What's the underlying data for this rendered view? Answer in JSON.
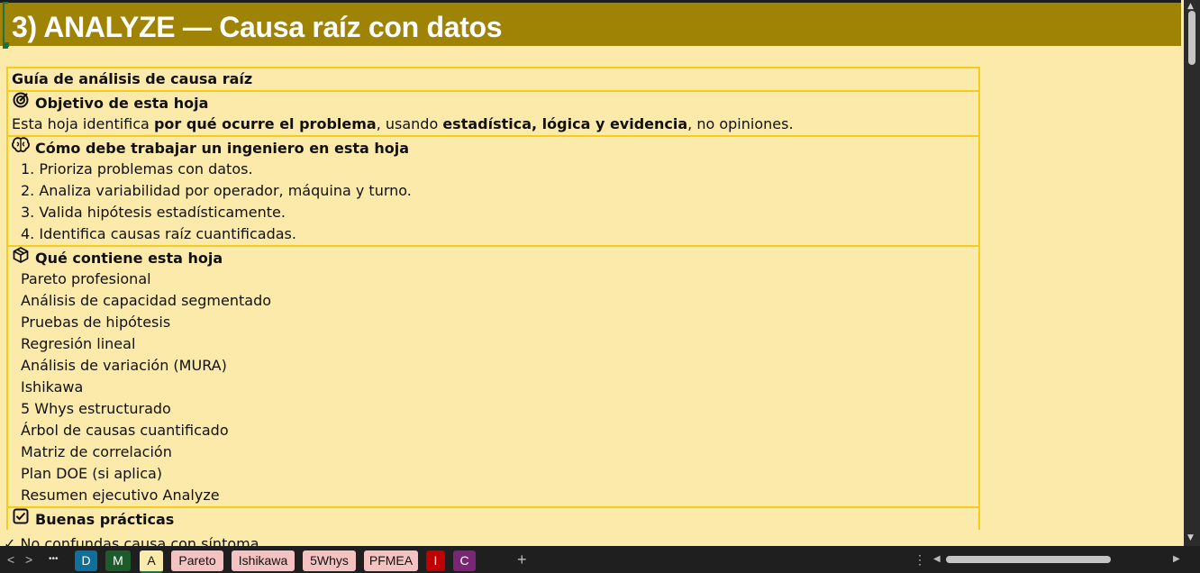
{
  "title": "3) ANALYZE — Causa raíz con datos",
  "guide": {
    "heading": "Guía de análisis de causa raíz",
    "objective": {
      "icon": "target-icon",
      "heading": "Objetivo de esta hoja",
      "text_a": "Esta hoja identifica ",
      "text_b": "por qué ocurre el problema",
      "text_c": ", usando ",
      "text_d": "estadística, lógica y evidencia",
      "text_e": ", no opiniones."
    },
    "howto": {
      "icon": "brain-icon",
      "heading": "Cómo debe trabajar un ingeniero en esta hoja",
      "steps": [
        "1. Prioriza problemas con datos.",
        "2. Analiza variabilidad por operador, máquina y turno.",
        "3. Valida hipótesis estadísticamente.",
        "4. Identifica causas raíz cuantificadas."
      ]
    },
    "contents": {
      "icon": "package-icon",
      "heading": "Qué contiene esta hoja",
      "items": [
        "Pareto profesional",
        "Análisis de capacidad segmentado",
        "Pruebas de hipótesis",
        "Regresión lineal",
        "Análisis de variación (MURA)",
        "Ishikawa",
        "5 Whys estructurado",
        "Árbol de causas cuantificado",
        "Matriz de correlación",
        "Plan DOE (si aplica)",
        "Resumen ejecutivo Analyze"
      ]
    },
    "practices": {
      "icon": "checkbox-icon",
      "heading": "Buenas prácticas",
      "first_item": "✓ No confundas causa con síntoma"
    }
  },
  "tabs": [
    {
      "label": "D",
      "color": "#0e6f9b",
      "dark": true
    },
    {
      "label": "M",
      "color": "#1e5b2a",
      "dark": true
    },
    {
      "label": "A",
      "color": "#fbeaaa",
      "dark": false
    },
    {
      "label": "Pareto",
      "color": "#f4c3c1",
      "dark": false
    },
    {
      "label": "Ishikawa",
      "color": "#f4c3c1",
      "dark": false
    },
    {
      "label": "5Whys",
      "color": "#f4c3c1",
      "dark": false
    },
    {
      "label": "PFMEA",
      "color": "#f4c3c1",
      "dark": false
    },
    {
      "label": "I",
      "color": "#c00000",
      "dark": true
    },
    {
      "label": "C",
      "color": "#7b2575",
      "dark": true
    }
  ],
  "tabbar_controls": {
    "prev": "<",
    "next": ">",
    "more": "•••",
    "add": "+",
    "options": "⋮",
    "scroll_left": "◀",
    "scroll_right": "▶"
  },
  "colors": {
    "title_bg": "#9f8305",
    "sheet_bg": "#fbeaaa",
    "border": "#f5cc1c"
  }
}
